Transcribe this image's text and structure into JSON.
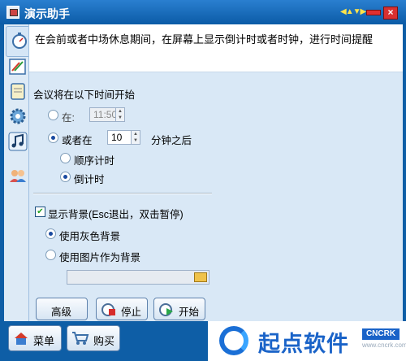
{
  "window": {
    "title": "演示助手"
  },
  "description": "在会前或者中场休息期间，在屏幕上显示倒计时或者时钟，进行时间提醒",
  "start_section": {
    "heading": "会议将在以下时间开始",
    "at_label": "在:",
    "at_time": "11:50",
    "or_label": "或者在",
    "minutes_value": "10",
    "minutes_suffix": "分钟之后",
    "count_up_label": "顺序计时",
    "count_down_label": "倒计时"
  },
  "background_section": {
    "show_bg_label": "显示背景(Esc退出，双击暂停)",
    "gray_bg_label": "使用灰色背景",
    "image_bg_label": "使用图片作为背景"
  },
  "buttons": {
    "advanced": "高级",
    "stop": "停止",
    "start": "开始"
  },
  "bottom": {
    "menu": "菜单",
    "buy": "购买"
  },
  "watermark": {
    "text": "起点软件",
    "tag": "CNCRK",
    "url": "www.cncrk.com"
  },
  "state": {
    "at_selected": false,
    "or_selected": true,
    "count_up_selected": false,
    "count_down_selected": true,
    "show_bg_checked": true,
    "gray_selected": true,
    "image_selected": false
  },
  "colors": {
    "frame": "#0e5ea6",
    "panel": "#d9e8f6",
    "accent": "#1a63c8"
  }
}
